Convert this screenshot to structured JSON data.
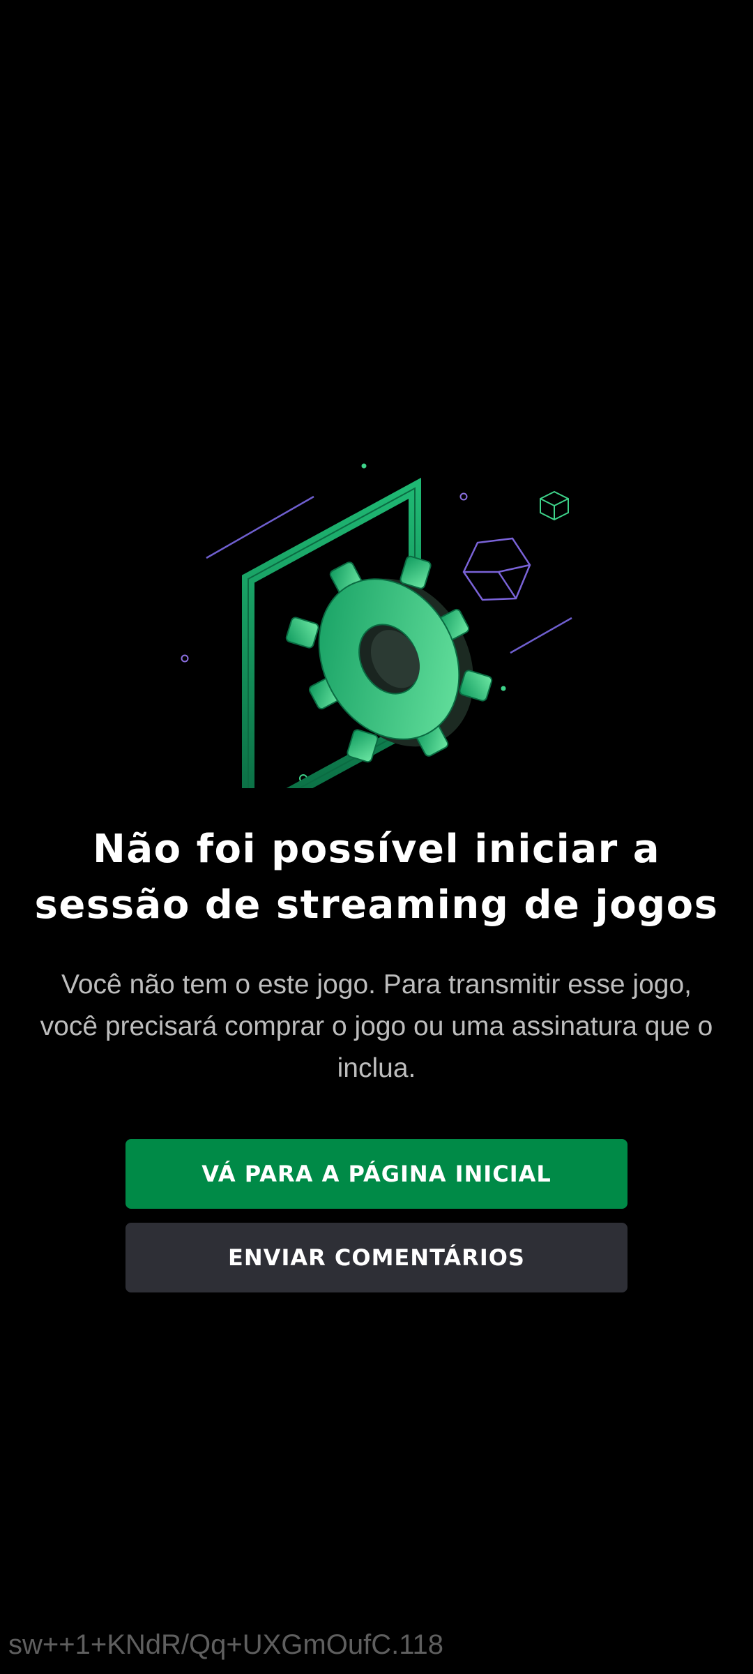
{
  "error": {
    "illustration_icon": "gear-in-frame-illustration",
    "title": "Não foi possível iniciar a sessão de streaming de jogos",
    "message": "Você não tem o este jogo. Para transmitir esse jogo, você precisará comprar o jogo ou uma assinatura que o inclua."
  },
  "actions": {
    "home_label": "VÁ PARA A PÁGINA INICIAL",
    "feedback_label": "ENVIAR COMENTÁRIOS"
  },
  "footer": {
    "session_id": "sw++1+KNdR/Qq+UXGmOufC.118"
  },
  "colors": {
    "background": "#000000",
    "primary_button": "#008a47",
    "secondary_button": "#2e2f36",
    "title_text": "#ffffff",
    "message_text": "#bdbdbd",
    "accent_green": "#3ed38a",
    "accent_purple": "#6f5fcf"
  }
}
